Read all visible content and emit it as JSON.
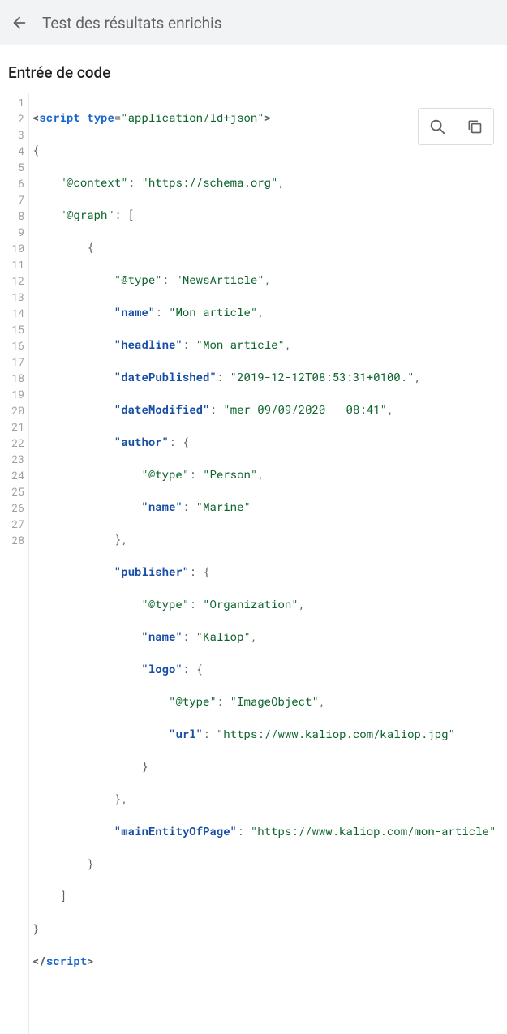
{
  "header": {
    "title": "Test des résultats enrichis"
  },
  "section_title": "Entrée de code",
  "code": {
    "language": "json-ld",
    "line_numbers": [
      1,
      2,
      3,
      4,
      5,
      6,
      7,
      8,
      9,
      10,
      11,
      12,
      13,
      14,
      15,
      16,
      17,
      18,
      19,
      20,
      21,
      22,
      23,
      24,
      25,
      26,
      27,
      28
    ],
    "script_open": {
      "tag": "script",
      "attr": "type",
      "attr_value": "application/ld+json"
    },
    "script_close": "script",
    "json_context_key": "@context",
    "json_context_val": "https://schema.org",
    "json_graph_key": "@graph",
    "article": {
      "type_key": "@type",
      "type_val": "NewsArticle",
      "name_key": "name",
      "name_val": "Mon article",
      "headline_key": "headline",
      "headline_val": "Mon article",
      "datePublished_key": "datePublished",
      "datePublished_val": "2019-12-12T08:53:31+0100.",
      "dateModified_key": "dateModified",
      "dateModified_val": "mer 09/09/2020 - 08:41",
      "author_key": "author",
      "author": {
        "type_key": "@type",
        "type_val": "Person",
        "name_key": "name",
        "name_val": "Marine"
      },
      "publisher_key": "publisher",
      "publisher": {
        "type_key": "@type",
        "type_val": "Organization",
        "name_key": "name",
        "name_val": "Kaliop",
        "logo_key": "logo",
        "logo": {
          "type_key": "@type",
          "type_val": "ImageObject",
          "url_key": "url",
          "url_val": "https://www.kaliop.com/kaliop.jpg"
        }
      },
      "mainEntity_key": "mainEntityOfPage",
      "mainEntity_val": "https://www.kaliop.com/mon-article"
    }
  }
}
